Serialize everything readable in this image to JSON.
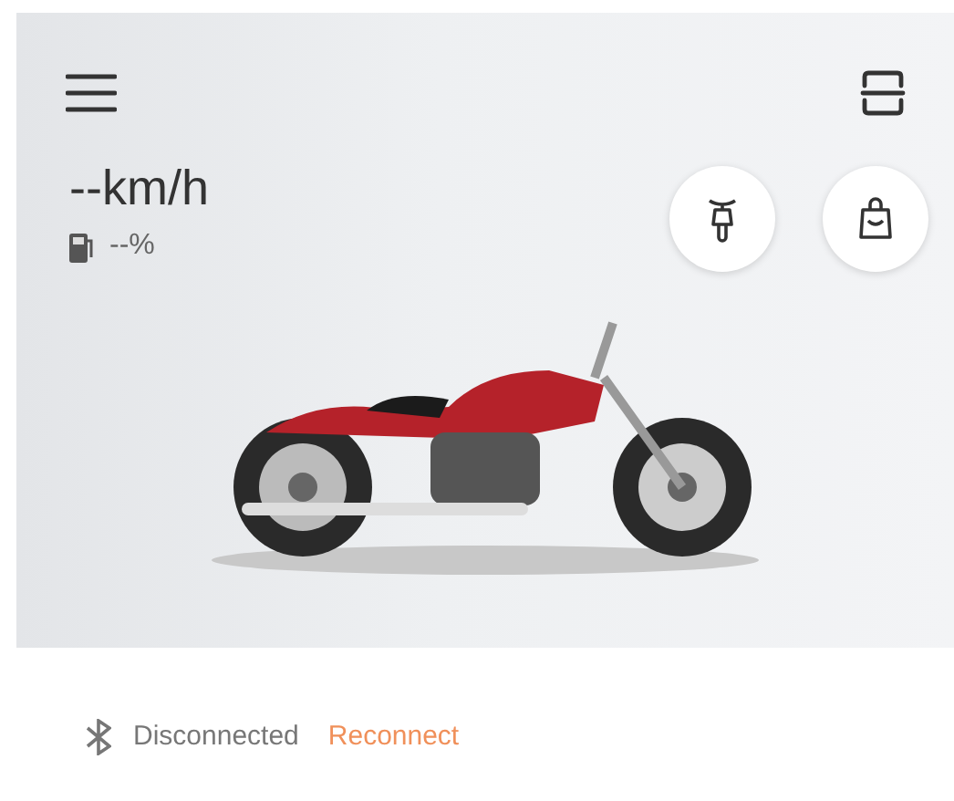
{
  "dashboard": {
    "speed": "--km/h",
    "fuel": "--%"
  },
  "connection": {
    "status": "Disconnected",
    "action": "Reconnect"
  }
}
